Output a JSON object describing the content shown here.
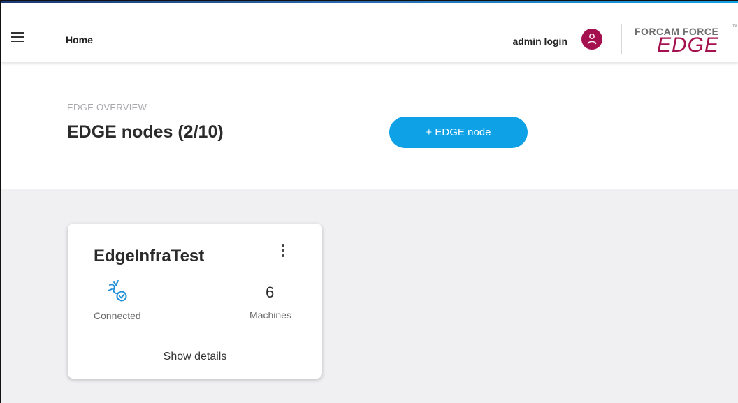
{
  "header": {
    "breadcrumb": "Home",
    "user_label": "admin login",
    "logo_top": "FORCAM FORCE",
    "logo_tm": "™",
    "logo_bottom": "EDGE"
  },
  "overview": {
    "section_label": "EDGE OVERVIEW",
    "title": "EDGE nodes  (2/10)",
    "add_button_label": "+ EDGE node"
  },
  "cards": [
    {
      "title": "EdgeInfraTest",
      "status_label": "Connected",
      "status_icon": "plug-connected-icon",
      "machines_count": "6",
      "machines_label": "Machines",
      "details_label": "Show details"
    }
  ],
  "colors": {
    "accent_blue": "#0ea1e6",
    "brand_crimson": "#a5114e",
    "background_gray": "#f0f0f2"
  }
}
